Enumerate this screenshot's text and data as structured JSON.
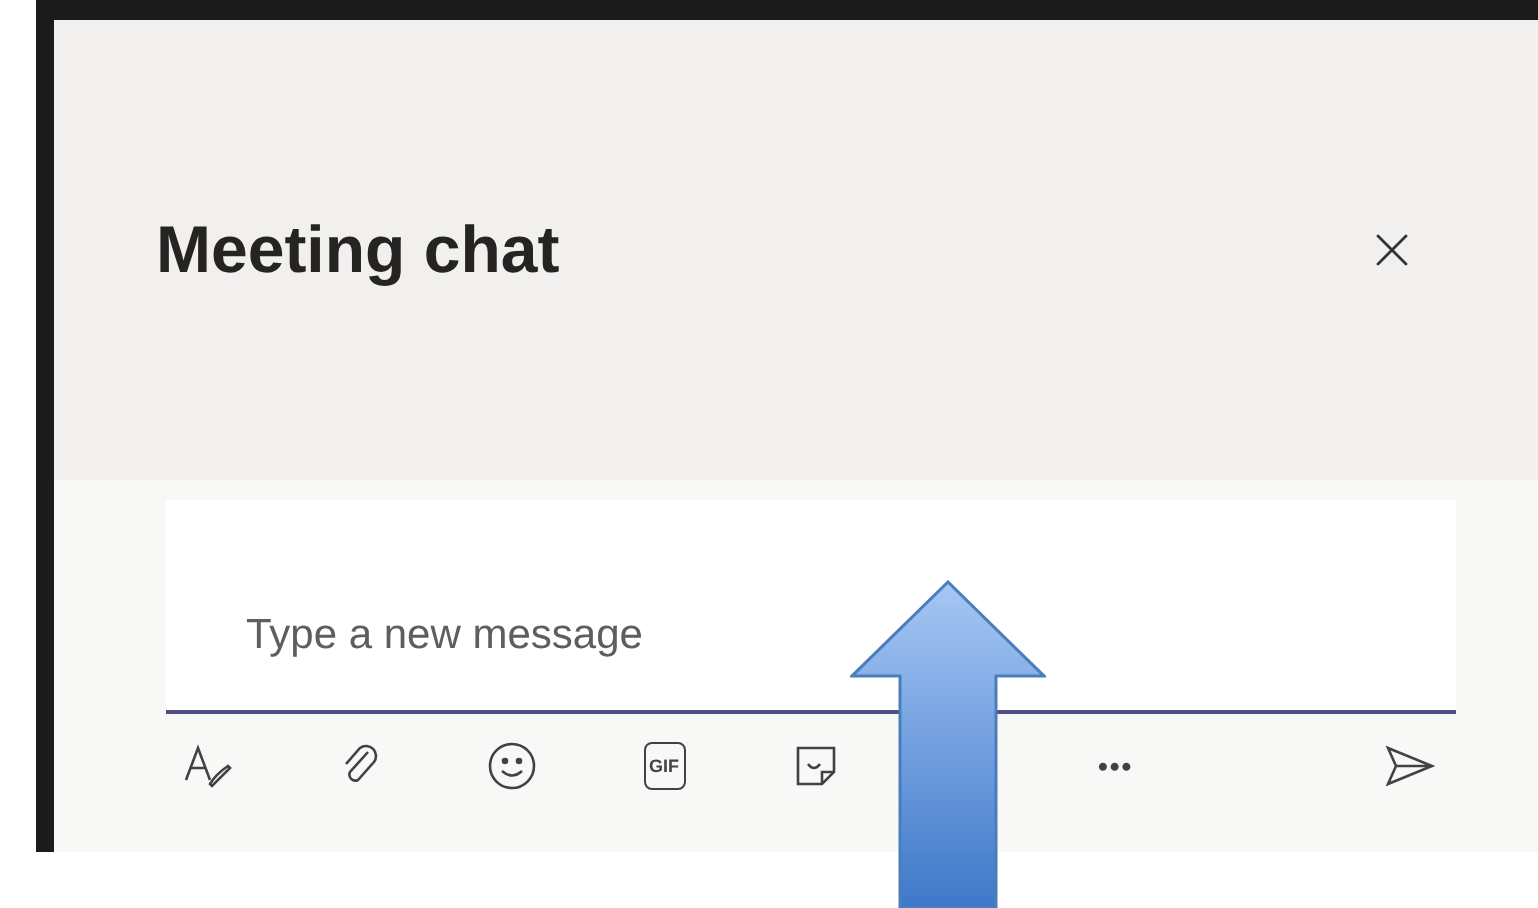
{
  "panel": {
    "title": "Meeting chat"
  },
  "composer": {
    "placeholder": "Type a new message"
  },
  "toolbar": {
    "items": [
      {
        "kind": "format"
      },
      {
        "kind": "attach"
      },
      {
        "kind": "emoji"
      },
      {
        "kind": "gif",
        "label": "GIF"
      },
      {
        "kind": "sticker"
      },
      {
        "kind": "more",
        "label": "•••"
      }
    ]
  }
}
